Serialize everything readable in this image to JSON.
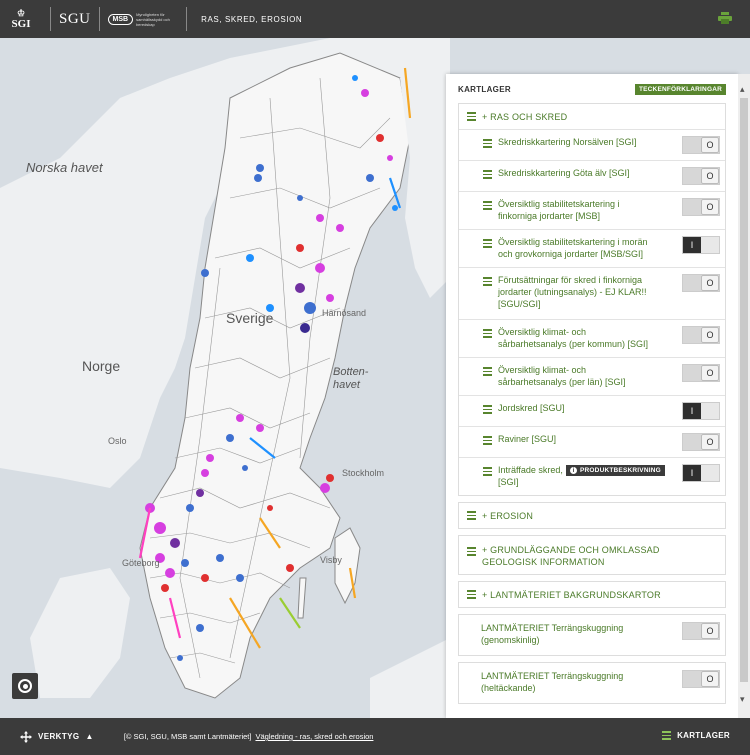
{
  "header": {
    "logos": [
      "SGI",
      "SGU",
      "MSB"
    ],
    "msb_tagline": "Myndigheten för samhällsskydd och beredskap",
    "title": "RAS, SKRED, EROSION",
    "print_icon": "printer-icon"
  },
  "map": {
    "labels": {
      "sea_norway": "Norska havet",
      "country_norway": "Norge",
      "country_sweden": "Sverige",
      "bothnia": "Botten-\nhavet",
      "oslo": "Oslo",
      "stockholm": "Stockholm",
      "goteborg": "Göteborg",
      "harnosand": "Härnösand",
      "visby": "Visby"
    },
    "locate_icon": "locate-icon"
  },
  "panel": {
    "title": "KARTLAGER",
    "legend_button": "TECKENFÖRKLARINGAR",
    "groups": [
      {
        "label": "+ RAS OCH SKRED",
        "layers": [
          {
            "label": "Skredriskkartering Norsälven [SGI]",
            "on": false
          },
          {
            "label": "Skredriskkartering Göta älv [SGI]",
            "on": false
          },
          {
            "label": "Översiktlig stabilitetskartering i finkorniga jordarter [MSB]",
            "on": false
          },
          {
            "label": "Översiktlig stabilitetskartering i morän och grovkorniga jordarter [MSB/SGI]",
            "on": true
          },
          {
            "label": "Förutsättningar för skred i finkorniga jordarter (lutningsanalys) - EJ KLAR!! [SGU/SGI]",
            "on": false
          },
          {
            "label": "Översiktlig klimat- och sårbarhetsanalys (per kommun) [SGI]",
            "on": false
          },
          {
            "label": "Översiktlig klimat- och sårbarhetsanalys (per län) [SGI]",
            "on": false
          },
          {
            "label": "Jordskred [SGU]",
            "on": true
          },
          {
            "label": "Raviner [SGU]",
            "on": false
          },
          {
            "label": "Inträffade skred, ras och jordrörelser [SGI]",
            "on": true
          }
        ]
      },
      {
        "label": "+ EROSION"
      },
      {
        "label": "+ GRUNDLÄGGANDE OCH OMKLASSAD GEOLOGISK INFORMATION"
      },
      {
        "label": "+ LANTMÄTERIET BAKGRUNDSKARTOR"
      }
    ],
    "extra_layers": [
      {
        "label": "LANTMÄTERIET Terrängskuggning (genomskinlig)",
        "on": false
      },
      {
        "label": "LANTMÄTERIET Terrängskuggning (heltäckande)",
        "on": false
      }
    ],
    "product_badge": "PRODUKTBESKRIVNING",
    "toggle_on_glyph": "I",
    "toggle_off_glyph": "O"
  },
  "footer": {
    "tools_label": "VERKTYG",
    "attribution": "[© SGI, SGU, MSB samt Lantmäteriet]",
    "guide_link": "Vägledning - ras, skred och erosion",
    "layers_label": "KARTLAGER"
  },
  "colors": {
    "header_bg": "#3b3b3b",
    "accent_green": "#58852e",
    "label_green": "#4a7a28"
  }
}
